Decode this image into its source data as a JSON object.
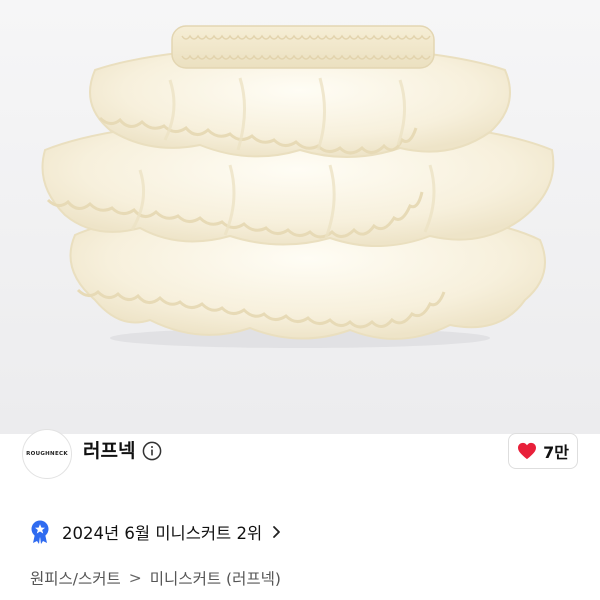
{
  "product": {
    "image_icon": "ruffle-mini-skirt-photo",
    "background_color": "#efeff1",
    "product_color": "#f8f2e2"
  },
  "brand": {
    "logo_text": "ROUGHNECK",
    "name": "러프넥",
    "info_icon": "info-circle-icon"
  },
  "like": {
    "icon": "heart-icon",
    "icon_color": "#e8203a",
    "count": "7만"
  },
  "ranking": {
    "badge_icon": "award-badge-icon",
    "badge_color": "#2f6bf0",
    "text": "2024년 6월 미니스커트 2위",
    "chevron_icon": "chevron-right-icon"
  },
  "breadcrumb": {
    "category": "원피스/스커트",
    "separator": ">",
    "subcategory": "미니스커트 (러프넥)"
  }
}
